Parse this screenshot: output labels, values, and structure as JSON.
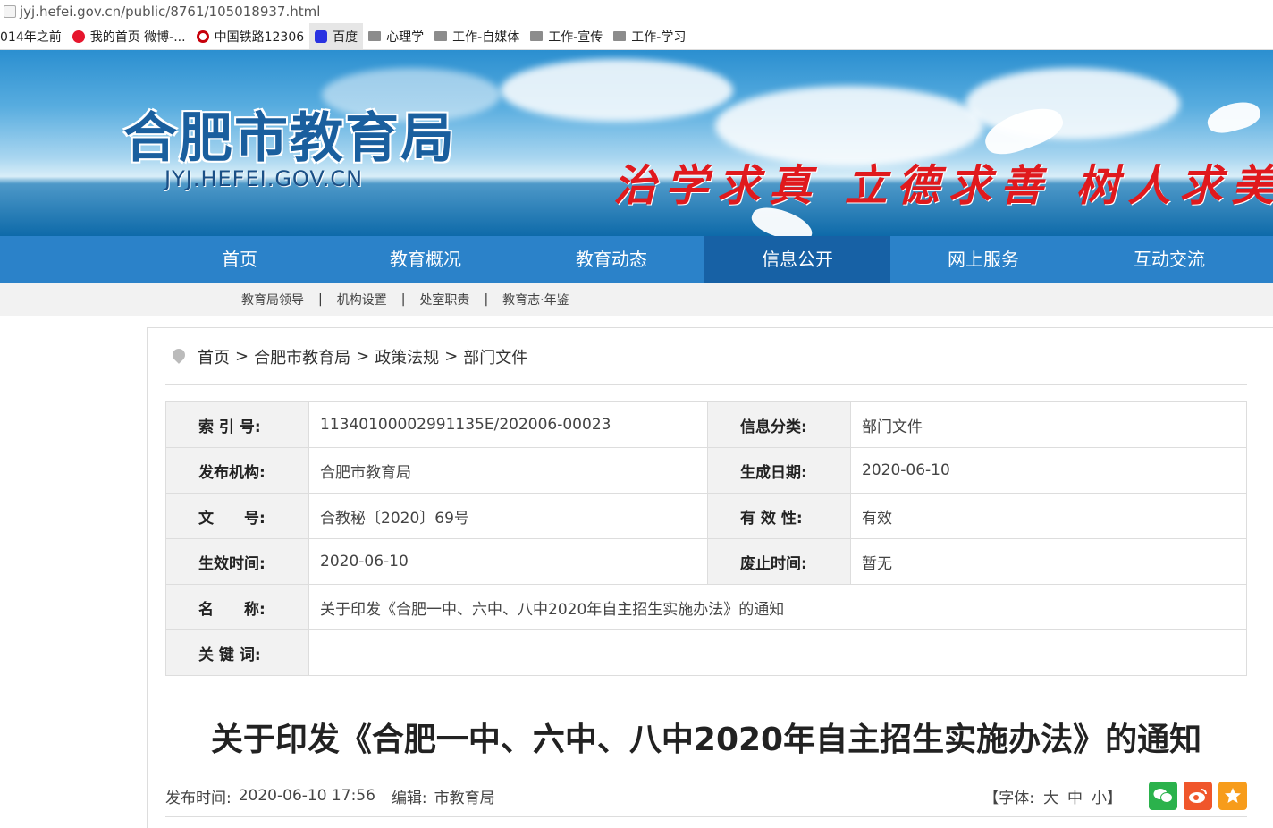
{
  "browser": {
    "url": "jyj.hefei.gov.cn/public/8761/105018937.html",
    "bookmarks": [
      {
        "label": "014年之前",
        "icon": "none"
      },
      {
        "label": "我的首页 微博-...",
        "icon": "weibo-icon"
      },
      {
        "label": "中国铁路12306",
        "icon": "railway-icon"
      },
      {
        "label": "百度",
        "icon": "baidu-icon"
      },
      {
        "label": "心理学",
        "icon": "folder-icon"
      },
      {
        "label": "工作-自媒体",
        "icon": "folder-icon"
      },
      {
        "label": "工作-宣传",
        "icon": "folder-icon"
      },
      {
        "label": "工作-学习",
        "icon": "folder-icon"
      }
    ]
  },
  "banner": {
    "title": "合肥市教育局",
    "url": "JYJ.HEFEI.GOV.CN",
    "motto": "治学求真 立德求善 树人求美"
  },
  "nav": {
    "items": [
      "首页",
      "教育概况",
      "教育动态",
      "信息公开",
      "网上服务",
      "互动交流"
    ],
    "active": "信息公开"
  },
  "subnav": [
    "教育局领导",
    "机构设置",
    "处室职责",
    "教育志·年鉴"
  ],
  "breadcrumb": [
    "首页",
    "合肥市教育局",
    "政策法规",
    "部门文件"
  ],
  "meta": {
    "index_no_label": "索 引 号:",
    "index_no": "11340100002991135E/202006-00023",
    "category_label": "信息分类:",
    "category": "部门文件",
    "publisher_label": "发布机构:",
    "publisher": "合肥市教育局",
    "created_label": "生成日期:",
    "created": "2020-06-10",
    "doc_no_label": "文　　号:",
    "doc_no": "合教秘〔2020〕69号",
    "validity_label": "有 效 性:",
    "validity": "有效",
    "effective_label": "生效时间:",
    "effective": "2020-06-10",
    "abolish_label": "废止时间:",
    "abolish": "暂无",
    "name_label": "名　　称:",
    "name": "关于印发《合肥一中、六中、八中2020年自主招生实施办法》的通知",
    "keywords_label": "关 键 词:",
    "keywords": ""
  },
  "article": {
    "title": "关于印发《合肥一中、六中、八中2020年自主招生实施办法》的通知",
    "publish_label": "发布时间:",
    "publish_time": "2020-06-10 17:56",
    "editor_label": "编辑:",
    "editor": "市教育局",
    "font_label": "【字体:",
    "font_large": "大",
    "font_medium": "中",
    "font_small": "小】"
  }
}
